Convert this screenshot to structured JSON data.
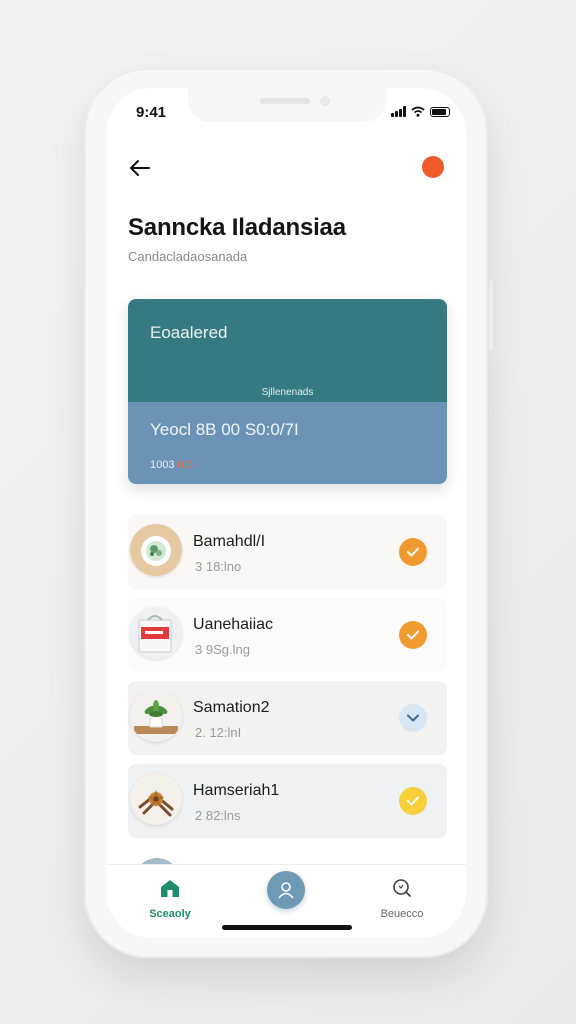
{
  "status_bar": {
    "time": "9:41"
  },
  "header": {
    "title": "Sanncka Iladansiaa",
    "subtitle": "Candacladaosanada"
  },
  "summary_card": {
    "heading": "Eoaalered",
    "mid_label": "Sjllenenads",
    "amount": "Yeocl 8B 00 S0:0/7I",
    "note_prefix": "1003",
    "note_highlight": "0.0"
  },
  "items": [
    {
      "name": "Bamahdl/I",
      "meta": "3  18:lno",
      "thumb_icon": "bowl-icon",
      "badge_icon": "check-icon",
      "badge_color": "#f19a2f"
    },
    {
      "name": "Uanehaiiac",
      "meta": "3  9Sg.lng",
      "thumb_icon": "bag-icon",
      "badge_icon": "check-icon",
      "badge_color": "#f19a2f"
    },
    {
      "name": "Samation2",
      "meta": "2.  12:lnI",
      "thumb_icon": "plant-icon",
      "badge_icon": "chevron-down-icon",
      "badge_color": "#d7e6f3"
    },
    {
      "name": "Hamseriah1",
      "meta": "2  82:lns",
      "thumb_icon": "spice-icon",
      "badge_icon": "check-icon",
      "badge_color": "#f6cf3b"
    }
  ],
  "tab_bar": {
    "left_label": "Sceaoly",
    "right_label": "Beuecco"
  },
  "colors": {
    "accent_orange": "#ef5a28",
    "card_teal": "#357a80",
    "card_blue": "#6a93b5",
    "active_tab": "#1f8a6d"
  }
}
